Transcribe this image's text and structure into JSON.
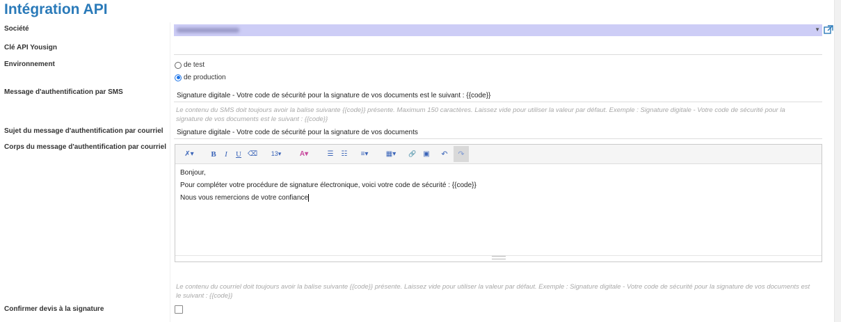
{
  "page": {
    "title": "Intégration API"
  },
  "fields": {
    "company": {
      "label": "Société",
      "value": "Margaret Le Roussier"
    },
    "api_key": {
      "label": "Clé API Yousign",
      "value": ""
    },
    "environment": {
      "label": "Environnement",
      "options": [
        {
          "label": "de test",
          "checked": false
        },
        {
          "label": "de production",
          "checked": true
        }
      ]
    },
    "sms_message": {
      "label": "Message d'authentification par SMS",
      "value": "Signature digitale - Votre code de sécurité pour la signature de vos documents est le suivant : {{code}}",
      "help": "Le contenu du SMS doit toujours avoir la balise suivante {{code}} présente. Maximum 150 caractères. Laissez vide pour utiliser la valeur par défaut. Exemple : Signature digitale - Votre code de sécurité pour la signature de vos documents est le suivant : {{code}}"
    },
    "email_subject": {
      "label": "Sujet du message d'authentification par courriel",
      "value": "Signature digitale - Votre code de sécurité pour la signature de vos documents"
    },
    "email_body": {
      "label": "Corps du message d'authentification par courriel",
      "lines": [
        "Bonjour,",
        "Pour compléter votre procédure de signature électronique, voici votre code de sécurité : {{code}}",
        "Nous vous remercions de votre confiance"
      ],
      "help": "Le contenu du courriel doit toujours avoir la balise suivante {{code}} présente. Laissez vide pour utiliser la valeur par défaut. Exemple : Signature digitale - Votre code de sécurité pour la signature de vos documents est le suivant : {{code}}",
      "toolbar": {
        "style": "✗▾",
        "bold": "B",
        "italic": "I",
        "underline": "U",
        "eraser": "⌫",
        "font_size": "13▾",
        "color": "A▾",
        "ul": "☰",
        "ol": "☷",
        "align": "≡▾",
        "table": "▦▾",
        "link": "🔗",
        "picture": "▣",
        "undo": "↶",
        "redo": "↷"
      }
    },
    "confirm_quote": {
      "label": "Confirmer devis à la signature",
      "checked": false
    }
  }
}
